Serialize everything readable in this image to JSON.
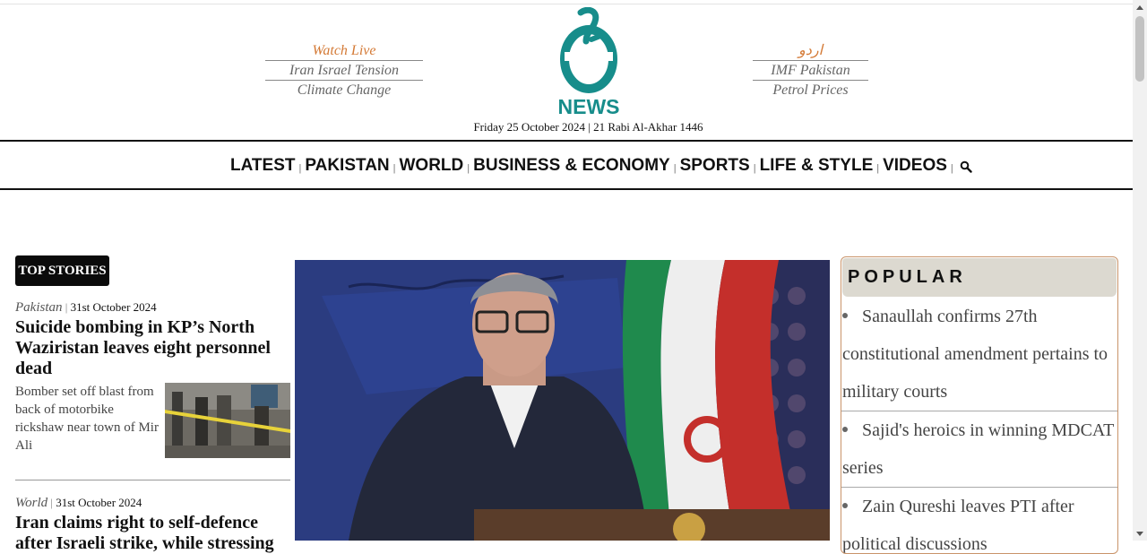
{
  "header": {
    "left_links": [
      "Watch Live",
      "Iran Israel Tension",
      "Climate Change"
    ],
    "right_links": [
      "اردو",
      "IMF Pakistan",
      "Petrol Prices"
    ],
    "logo_text": "NEWS",
    "dateline": "Friday 25 October 2024 | 21 Rabi Al-Akhar 1446",
    "accent_color": "#d47a36",
    "brand_color": "#178d8b"
  },
  "nav": {
    "items": [
      "LATEST",
      "PAKISTAN",
      "WORLD",
      "BUSINESS & ECONOMY",
      "SPORTS",
      "LIFE & STYLE",
      "VIDEOS"
    ],
    "search_icon": "search-icon"
  },
  "top_stories": {
    "badge": "TOP STORIES",
    "stories": [
      {
        "category": "Pakistan",
        "date": "31st October 2024",
        "title": "Suicide bombing in KP’s North Waziristan leaves eight personnel dead",
        "excerpt": "Bomber set off blast from back of motorbike rickshaw near town of Mir Ali"
      },
      {
        "category": "World",
        "date": "31st October 2024",
        "title": "Iran claims right to self-defence after Israeli strike, while stressing"
      }
    ]
  },
  "popular": {
    "heading": "POPULAR",
    "items": [
      "Sanaullah confirms 27th constitutional amendment pertains to military courts",
      "Sajid's heroics in winning MDCAT series",
      "Zain Qureshi leaves PTI after political discussions"
    ]
  }
}
